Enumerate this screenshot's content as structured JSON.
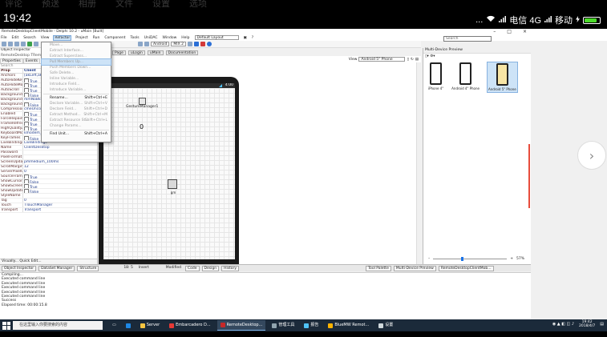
{
  "ghost_tabs": [
    "评论",
    "预送",
    "相册",
    "文件",
    "设置",
    "选项"
  ],
  "status": {
    "time": "19:42",
    "dots": "...",
    "carrier1": "电信 4G",
    "carrier2": "移动"
  },
  "ide": {
    "title": "RemoteDesktopClientMobile - Delphi 10.2 - uMain [Built]",
    "menu": [
      "File",
      "Edit",
      "Search",
      "View",
      "Refactor",
      "Project",
      "Run",
      "Component",
      "Tools",
      "UniDAC",
      "Window",
      "Help"
    ],
    "layout": "Default Layout",
    "search_placeholder": "Search",
    "toolbar": {
      "platform": "Android",
      "target": "MIX 2"
    },
    "design_tabs": [
      "Page",
      "uLogin",
      "uMain",
      "Documentation"
    ],
    "view_label": "View",
    "view_device": "Android 5\" Phone"
  },
  "object_inspector": {
    "title": "Object Inspector",
    "subtitle": "RemoteDesktop TRemoteDeskt",
    "tabs": [
      "Properties",
      "Events"
    ],
    "filter_placeholder": "Search",
    "col_prop": "Prop",
    "col_val": "Client",
    "rows": [
      {
        "prop": "Anchors",
        "val": "[akLeft,akT"
      },
      {
        "prop": "AutoHideKeyboar",
        "val": "True"
      },
      {
        "prop": "AutoHideMouse",
        "val": "True"
      },
      {
        "prop": "AutoScroll",
        "val": "True"
      },
      {
        "prop": "BackgroundAnyf",
        "val": "False"
      },
      {
        "prop": "BackgroundMode",
        "val": "mmNoBkg"
      },
      {
        "prop": "BackgroundAnyf",
        "val": "False"
      },
      {
        "prop": "CompressionMeth",
        "val": "cmeUnco"
      },
      {
        "prop": "Enabled",
        "val": "True"
      },
      {
        "prop": "ForceRepaint",
        "val": "True"
      },
      {
        "prop": "FrameRefreshNe",
        "val": "True"
      },
      {
        "prop": "HighQualityAuto",
        "val": "True"
      },
      {
        "prop": "KeyboardMode",
        "val": "kmodem_standard"
      },
      {
        "prop": "KeyFrames",
        "val": "False"
      },
      {
        "prop": "LiveBindings",
        "val": "LiveBindings"
      },
      {
        "prop": "Name",
        "val": "ClientDesktop"
      },
      {
        "prop": "Password",
        "val": ""
      },
      {
        "prop": "PixelFormat",
        "val": ""
      },
      {
        "prop": "ScreenUpdateInte",
        "val": "pmmedium_100ms"
      },
      {
        "prop": "ScrollMargin",
        "val": "12"
      },
      {
        "prop": "ServerPixelQualit",
        "val": "0"
      },
      {
        "prop": "SourceFrameCount",
        "val": "True"
      },
      {
        "prop": "ShowCursor",
        "val": "False"
      },
      {
        "prop": "ShowScreenMargi",
        "val": "True"
      },
      {
        "prop": "ShowUpdateRegi",
        "val": "False"
      },
      {
        "prop": "StyleName",
        "val": ""
      },
      {
        "prop": "Tag",
        "val": "0"
      },
      {
        "prop": "Touch",
        "val": "TTouchManager"
      },
      {
        "prop": "Transport",
        "val": "Transport"
      }
    ],
    "footer": "Visually... Quick Edit..."
  },
  "refactor_menu": [
    {
      "label": "Move...",
      "shortcut": "",
      "enabled": false
    },
    {
      "label": "Extract Interface...",
      "shortcut": "",
      "enabled": false
    },
    {
      "label": "Extract Superclass...",
      "shortcut": "",
      "enabled": false
    },
    {
      "label": "Pull Members Up...",
      "shortcut": "",
      "enabled": false,
      "highlight": true
    },
    {
      "label": "Push Members Down...",
      "shortcut": "",
      "enabled": false
    },
    {
      "label": "Safe Delete...",
      "shortcut": "",
      "enabled": false
    },
    {
      "label": "Inline Variable...",
      "shortcut": "",
      "enabled": false
    },
    {
      "label": "Introduce Field...",
      "shortcut": "",
      "enabled": false
    },
    {
      "label": "Introduce Variable...",
      "shortcut": "",
      "enabled": false
    },
    {
      "label": "Rename...",
      "shortcut": "Shift+Ctrl+E",
      "enabled": true
    },
    {
      "label": "Declare Variable...",
      "shortcut": "Shift+Ctrl+V",
      "enabled": false
    },
    {
      "label": "Declare Field...",
      "shortcut": "Shift+Ctrl+D",
      "enabled": false
    },
    {
      "label": "Extract Method...",
      "shortcut": "Shift+Ctrl+M",
      "enabled": false
    },
    {
      "label": "Extract Resource St...",
      "shortcut": "Shift+Ctrl+L",
      "enabled": false
    },
    {
      "label": "Change Params...",
      "shortcut": "",
      "enabled": false
    },
    {
      "label": "Find Unit...",
      "shortcut": "Shift+Ctrl+A",
      "enabled": true
    }
  ],
  "design": {
    "status_clock": "4:00",
    "component1": "GestureManager1",
    "counter": "0",
    "component2": "gm"
  },
  "multi_device": {
    "title": "Multi-Device Preview",
    "devices": [
      {
        "label": "iPhone 4\"",
        "selected": false
      },
      {
        "label": "Android 4\" Phone",
        "selected": false
      },
      {
        "label": "Android 5\" Phone",
        "selected": true
      }
    ],
    "zoom": "57%"
  },
  "dock": {
    "tabs": [
      "Object Inspector",
      "DataSet Manager",
      "Structure"
    ],
    "position": "18: 5",
    "insert_mode": "Insert",
    "modified": "Modified",
    "editor_tabs": [
      "Code",
      "Design",
      "History"
    ],
    "right_tabs": [
      "Tool Palette",
      "Multi-Device Preview",
      "RemoteDesktopClientMob..."
    ]
  },
  "messages": {
    "lines": [
      "Compiling...",
      "Executed command line",
      "Executed command line",
      "Executed command line",
      "Executed command line",
      "Executed command line",
      "Success",
      "Elapsed time: 00:00:15.8",
      "Build",
      "Output"
    ],
    "tabs": [
      "Build",
      "Output"
    ]
  },
  "taskbar": {
    "search": "在这里输入你要搜索的内容",
    "apps": [
      "Server",
      "Embarcadero D...",
      "RemoteDesktop...",
      "管理工具",
      "报告",
      "BlueMW Remot...",
      "设置"
    ],
    "clock_time": "19:42",
    "clock_date": "2018/4/7"
  }
}
